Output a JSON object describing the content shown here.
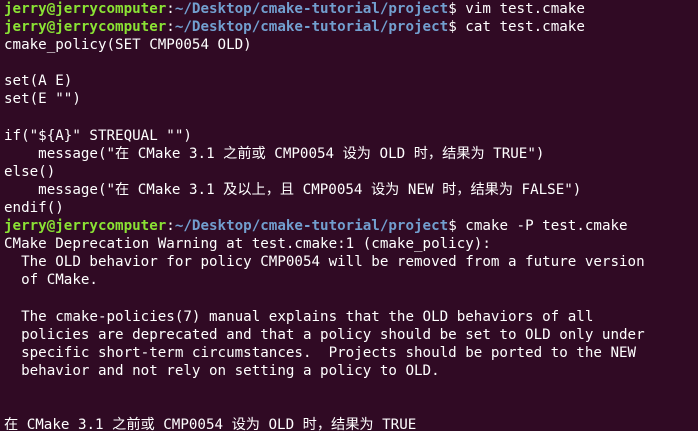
{
  "prompt": {
    "user_host": "jerry@jerrycomputer",
    "colon": ":",
    "path": "~/Desktop/cmake-tutorial/project",
    "symbol": "$ "
  },
  "colors": {
    "background": "#300a24",
    "prompt_user": "#8ae234",
    "prompt_path": "#729fcf",
    "text": "#ffffff"
  },
  "lines": [
    {
      "type": "prompt",
      "command": "vim test.cmake"
    },
    {
      "type": "prompt",
      "command": "cat test.cmake"
    },
    {
      "type": "output",
      "text": "cmake_policy(SET CMP0054 OLD)"
    },
    {
      "type": "output",
      "text": ""
    },
    {
      "type": "output",
      "text": "set(A E)"
    },
    {
      "type": "output",
      "text": "set(E \"\")"
    },
    {
      "type": "output",
      "text": ""
    },
    {
      "type": "output",
      "text": "if(\"${A}\" STREQUAL \"\")"
    },
    {
      "type": "output",
      "text": "    message(\"在 CMake 3.1 之前或 CMP0054 设为 OLD 时，结果为 TRUE\")"
    },
    {
      "type": "output",
      "text": "else()"
    },
    {
      "type": "output",
      "text": "    message(\"在 CMake 3.1 及以上，且 CMP0054 设为 NEW 时，结果为 FALSE\")"
    },
    {
      "type": "output",
      "text": "endif()"
    },
    {
      "type": "prompt",
      "command": "cmake -P test.cmake"
    },
    {
      "type": "output",
      "text": "CMake Deprecation Warning at test.cmake:1 (cmake_policy):"
    },
    {
      "type": "output",
      "text": "  The OLD behavior for policy CMP0054 will be removed from a future version"
    },
    {
      "type": "output",
      "text": "  of CMake."
    },
    {
      "type": "output",
      "text": ""
    },
    {
      "type": "output",
      "text": "  The cmake-policies(7) manual explains that the OLD behaviors of all"
    },
    {
      "type": "output",
      "text": "  policies are deprecated and that a policy should be set to OLD only under"
    },
    {
      "type": "output",
      "text": "  specific short-term circumstances.  Projects should be ported to the NEW"
    },
    {
      "type": "output",
      "text": "  behavior and not rely on setting a policy to OLD."
    },
    {
      "type": "output",
      "text": ""
    },
    {
      "type": "output",
      "text": ""
    },
    {
      "type": "output",
      "text": "在 CMake 3.1 之前或 CMP0054 设为 OLD 时，结果为 TRUE"
    }
  ]
}
